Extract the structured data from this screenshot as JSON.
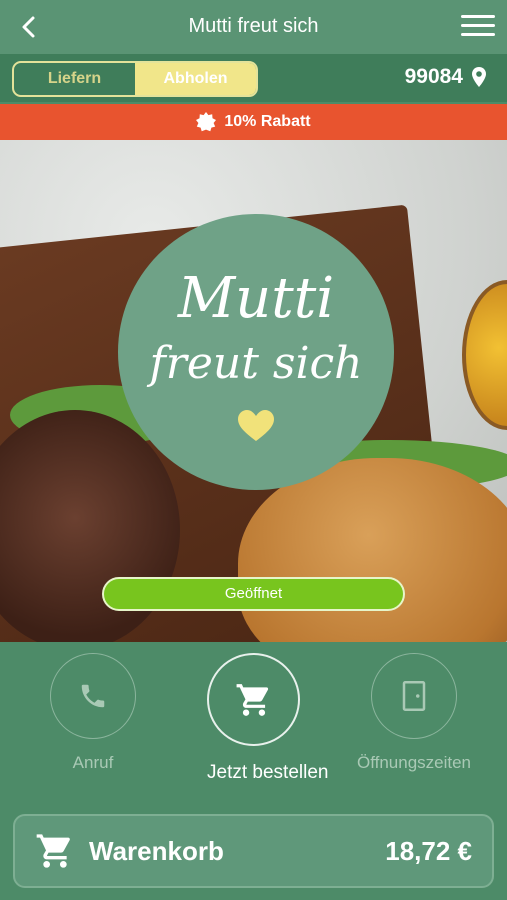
{
  "header": {
    "title": "Mutti freut sich",
    "back_icon": "chevron-left-icon",
    "menu_icon": "hamburger-menu-icon"
  },
  "mode": {
    "options": [
      "Liefern",
      "Abholen"
    ],
    "selected": "Abholen"
  },
  "location": {
    "postal_code": "99084",
    "icon": "map-pin-icon"
  },
  "promo": {
    "text": "10% Rabatt",
    "icon": "badge-icon"
  },
  "hero": {
    "logo_line1": "Mutti",
    "logo_line2": "freut sich",
    "status": "Geöffnet"
  },
  "actions": [
    {
      "label": "Anruf",
      "icon": "phone-icon"
    },
    {
      "label": "Jetzt bestellen",
      "icon": "cart-icon"
    },
    {
      "label": "Öffnungszeiten",
      "icon": "door-icon"
    }
  ],
  "cart": {
    "label": "Warenkorb",
    "total": "18,72 €",
    "icon": "cart-icon"
  },
  "colors": {
    "primary": "#4d8b68",
    "accent": "#e8542f",
    "open": "#78c51e",
    "highlight": "#f1e68a"
  }
}
